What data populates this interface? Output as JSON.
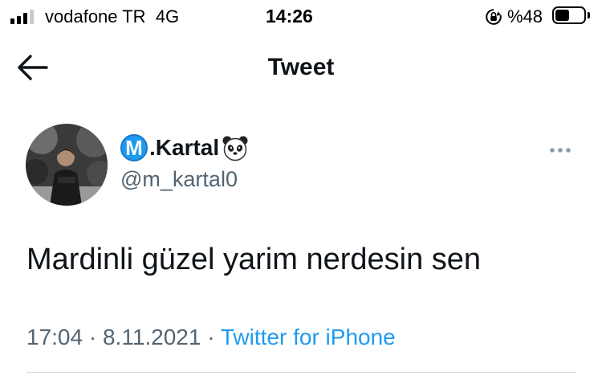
{
  "status_bar": {
    "carrier": "vodafone TR",
    "network": "4G",
    "time": "14:26",
    "battery_percent": "%48",
    "signal_bars_active": 3,
    "signal_bars_total": 4
  },
  "header": {
    "title": "Tweet",
    "back_icon": "arrow-left-icon"
  },
  "tweet": {
    "author": {
      "name_badge": "M",
      "name": ".Kartal",
      "name_emoji": "panda-face-icon",
      "handle": "@m_kartal0"
    },
    "text": "Mardinli güzel yarim nerdesin sen",
    "time": "17:04",
    "separator": "·",
    "date": "8.11.2021",
    "source": "Twitter for iPhone",
    "more_icon": "more-horizontal-icon"
  },
  "colors": {
    "accent": "#1d9bf0",
    "secondary_text": "#536471",
    "primary_text": "#0f1419"
  }
}
